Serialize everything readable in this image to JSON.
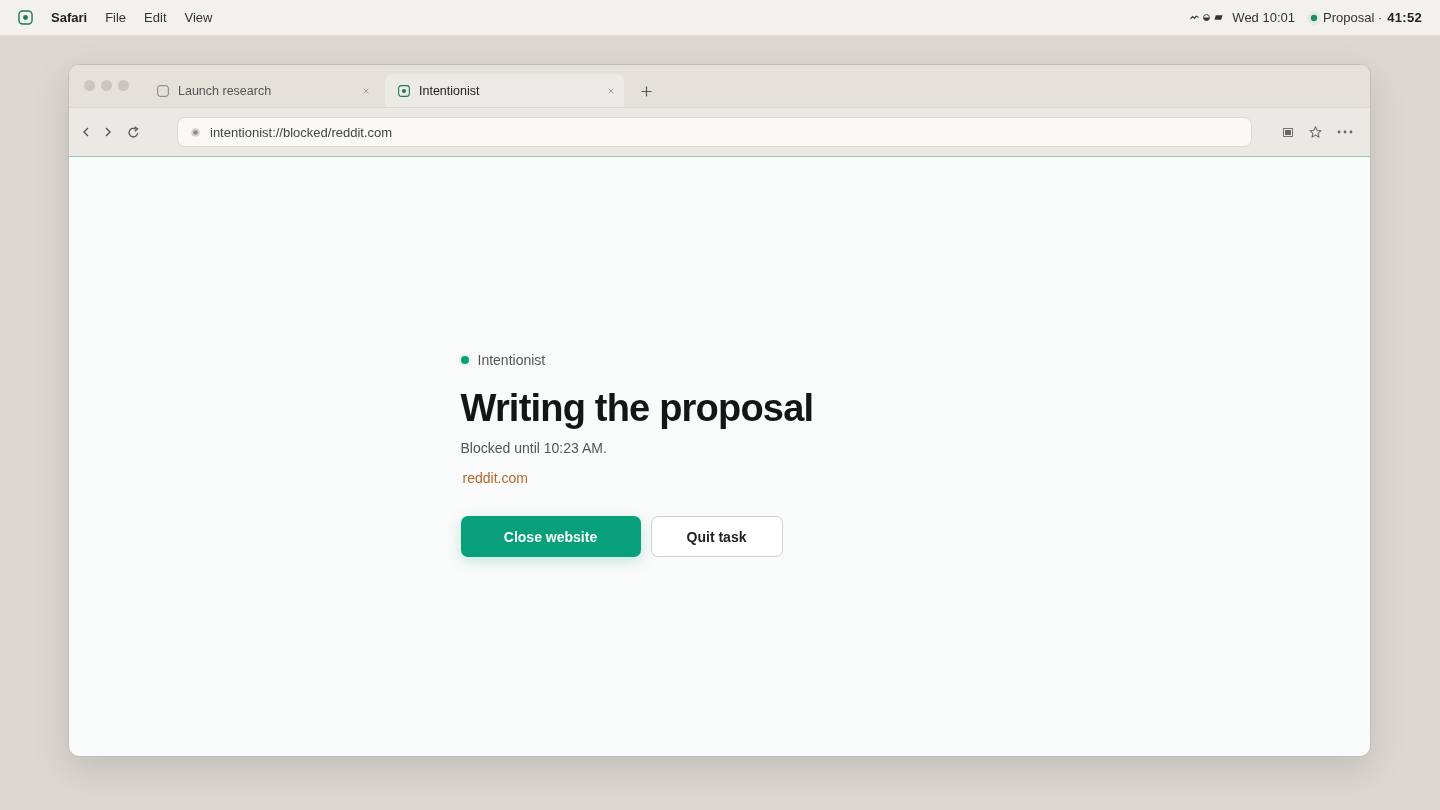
{
  "menubar": {
    "app": "Safari",
    "menus": [
      "File",
      "Edit",
      "View"
    ],
    "clock": "Wed 10:01",
    "timer": {
      "task": "Proposal ·",
      "time": "41:52"
    }
  },
  "browser": {
    "tabs": [
      {
        "title": "Launch research",
        "kind": "blank",
        "selected": false
      },
      {
        "title": "Intentionist",
        "kind": "app",
        "selected": true
      }
    ],
    "address": {
      "value": "intentionist://blocked/reddit.com"
    }
  },
  "page": {
    "brand": "Intentionist",
    "title": "Writing the proposal",
    "subtitle": "Blocked until 10:23 AM.",
    "site": "reddit.com",
    "buttons": [
      {
        "label": "Close website",
        "kind": "primary"
      },
      {
        "label": "Quit task",
        "kind": "secondary"
      }
    ]
  }
}
